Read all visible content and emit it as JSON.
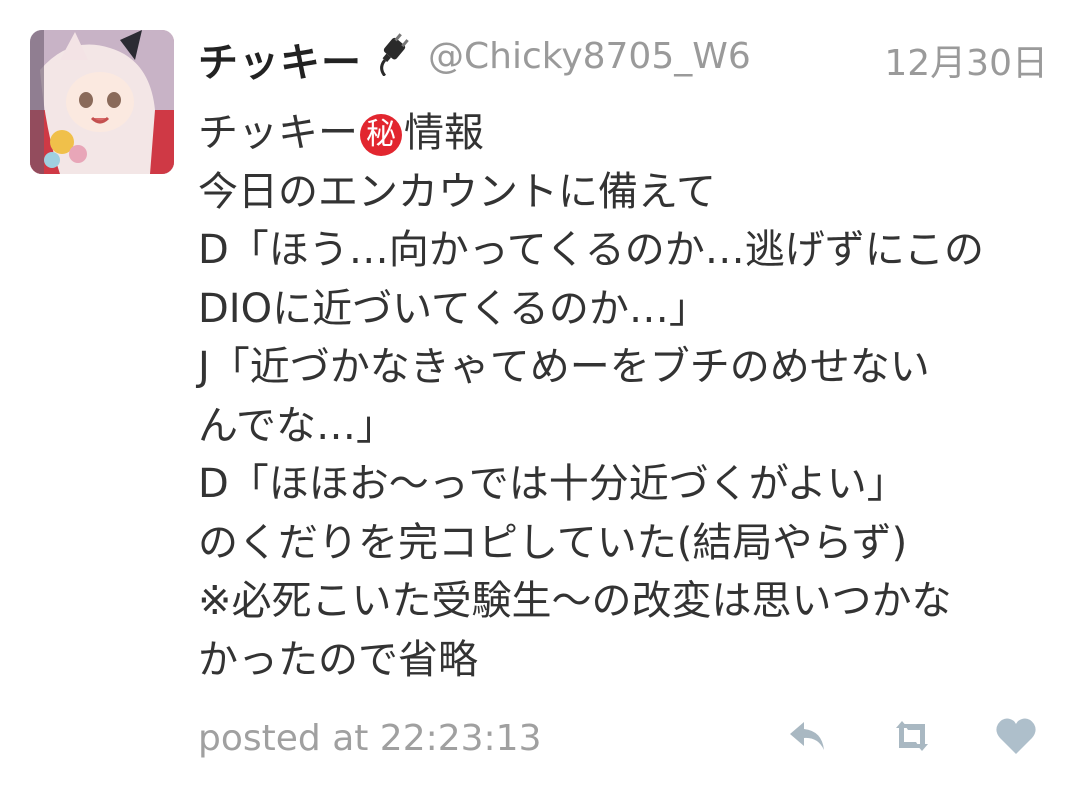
{
  "user": {
    "display_name": "チッキー",
    "name_icon": "electric-plug-icon",
    "handle": "@Chicky8705_W6",
    "avatar": "user-avatar"
  },
  "tweet": {
    "date": "12月30日",
    "line1_before": "チッキー",
    "line1_mark": "秘",
    "line1_after": "情報",
    "lines": [
      "今日のエンカウントに備えて",
      "D「ほう…向かってくるのか…逃げずにこの",
      "DIOに近づいてくるのか…」",
      "J「近づかなきゃてめーをブチのめせない",
      "んでな…」",
      "D「ほほお～っでは十分近づくがよい」",
      "のくだりを完コピしていた(結局やらず)",
      "※必死こいた受験生～の改変は思いつかな",
      "かったので省略"
    ],
    "posted_at": "posted at 22:23:13"
  },
  "actions": {
    "reply_icon": "reply-icon",
    "retweet_icon": "retweet-icon",
    "favorite_icon": "heart-icon"
  },
  "colors": {
    "text": "#333333",
    "meta": "#9a9a9a",
    "icon": "#a9b8c2",
    "heart": "#aebfcb",
    "secret_red": "#e2262f"
  }
}
